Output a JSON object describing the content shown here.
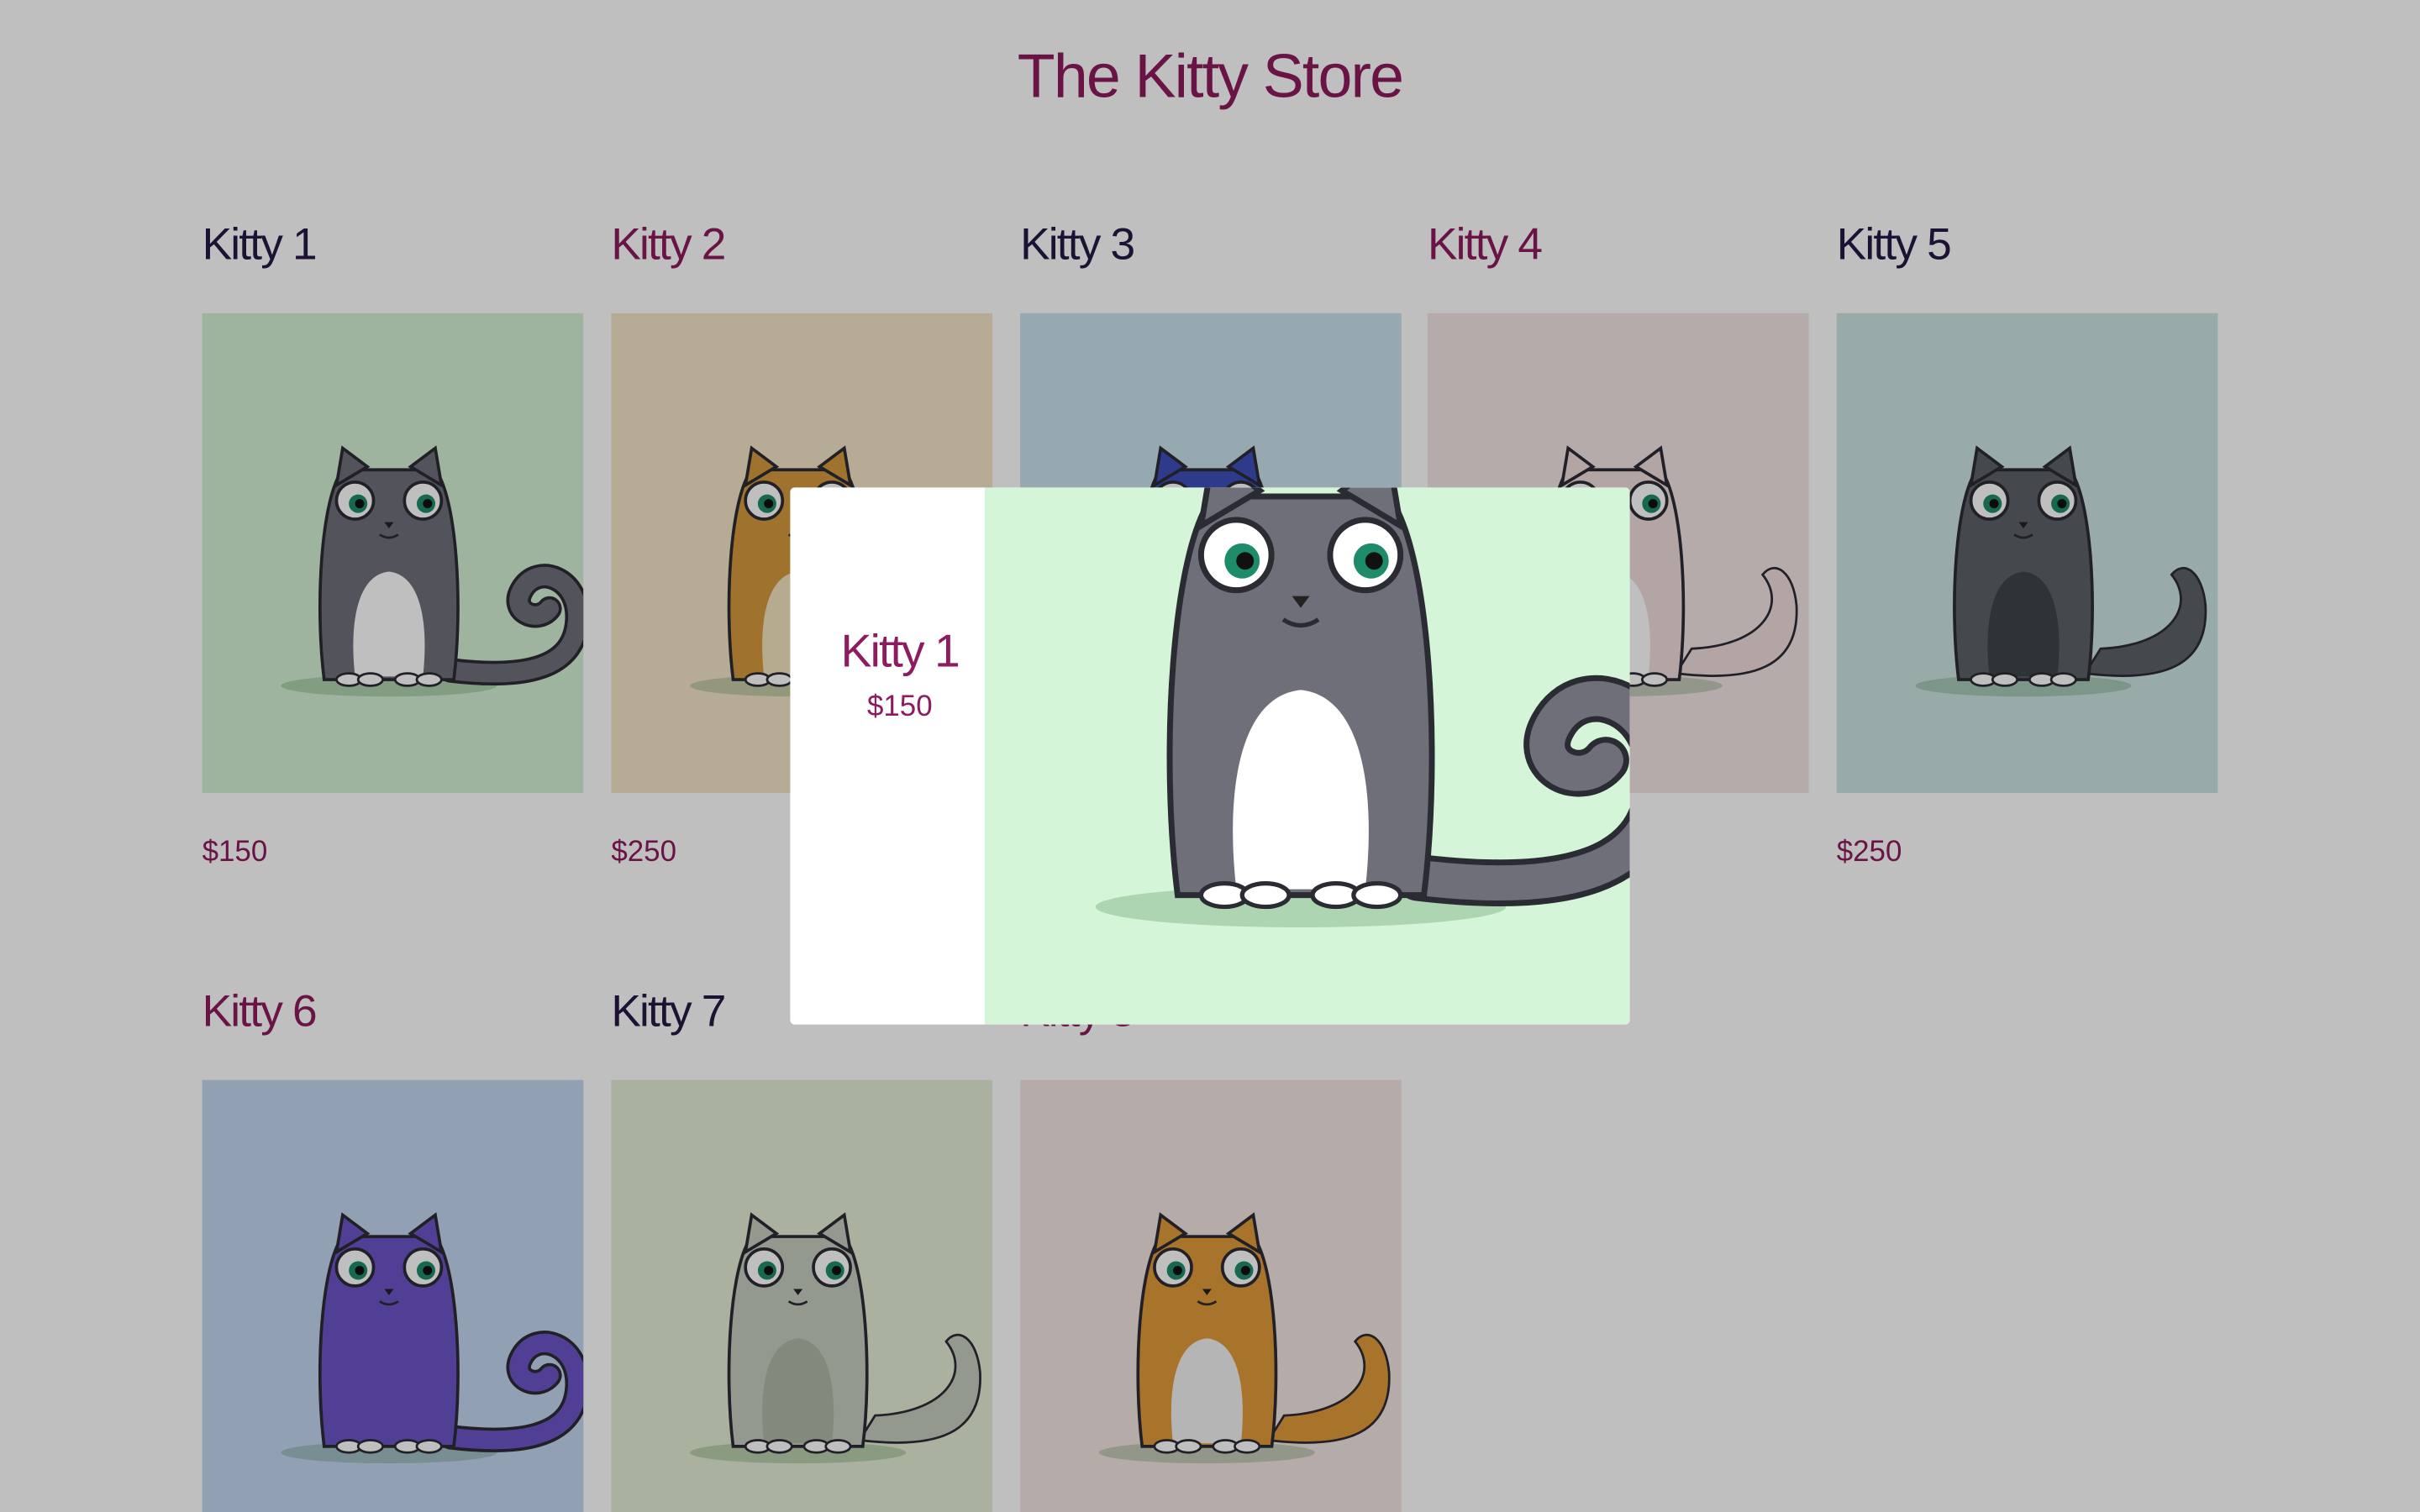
{
  "store": {
    "title": "The Kitty Store"
  },
  "kitties": [
    {
      "name": "Kitty 1",
      "price": "$150",
      "name_color": "#261945",
      "bg": "#d4f1d5",
      "body": "#6f6f7a",
      "belly": "#ffffff",
      "tail": "curl"
    },
    {
      "name": "Kitty 2",
      "price": "$250",
      "name_color": "#8e1b5e",
      "bg": "#f3e6c8",
      "body": "#d5993c",
      "belly": "#f5e5bf",
      "tail": "none"
    },
    {
      "name": "Kitty 3",
      "price": "",
      "name_color": "#261945",
      "bg": "#c9e2ec",
      "body": "#3c4fb8",
      "belly": "#e6ecff",
      "tail": "none"
    },
    {
      "name": "Kitty 4",
      "price": "",
      "name_color": "#8e1b5e",
      "bg": "#f2e4e5",
      "body": "#f0dcdc",
      "belly": "#ffffff",
      "tail": "fluffy"
    },
    {
      "name": "Kitty 5",
      "price": "$250",
      "name_color": "#261945",
      "bg": "#cbe5e2",
      "body": "#5c6267",
      "belly": "#3e4448",
      "tail": "fluffy"
    },
    {
      "name": "Kitty 6",
      "price": "",
      "name_color": "#8e1b5e",
      "bg": "#c3d6f1",
      "body": "#6b55c6",
      "belly": "#6b55c6",
      "tail": "curl"
    },
    {
      "name": "Kitty 7",
      "price": "",
      "name_color": "#261945",
      "bg": "#e3ecd5",
      "body": "#c6ccc0",
      "belly": "#aeb9a9",
      "tail": "fluffy"
    },
    {
      "name": "Kitty 8",
      "price": "",
      "name_color": "#8e1b5e",
      "bg": "#f2e6e2",
      "body": "#e19a3a",
      "belly": "#f2f2f2",
      "tail": "fluffy"
    }
  ],
  "modal": {
    "name": "Kitty 1",
    "price": "$150",
    "bg": "#d5f5d8"
  },
  "colors": {
    "overlay": "rgba(0,0,0,0.25)",
    "accent": "#8e1b5e",
    "dark": "#261945"
  }
}
